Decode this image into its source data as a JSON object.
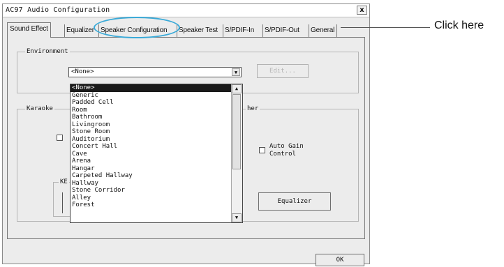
{
  "window": {
    "title": "AC97 Audio Configuration",
    "close_glyph": "x"
  },
  "tabs": [
    {
      "label": "Sound Effect",
      "active": true
    },
    {
      "label": "Equalizer",
      "active": false
    },
    {
      "label": "Speaker Configuration",
      "active": false
    },
    {
      "label": "Speaker Test",
      "active": false
    },
    {
      "label": "S/PDIF-In",
      "active": false
    },
    {
      "label": "S/PDIF-Out",
      "active": false
    },
    {
      "label": "General",
      "active": false
    }
  ],
  "environment": {
    "label": "Environment",
    "selected": "<None>",
    "edit_button": "Edit...",
    "options": [
      "<None>",
      "Generic",
      "Padded Cell",
      "Room",
      "Bathroom",
      "Livingroom",
      "Stone Room",
      "Auditorium",
      "Concert Hall",
      "Cave",
      "Arena",
      "Hangar",
      "Carpeted Hallway",
      "Hallway",
      "Stone Corridor",
      "Alley",
      "Forest"
    ]
  },
  "karaoke": {
    "label": "Karaoke",
    "key_label": "KE"
  },
  "other": {
    "label_fragment": "her",
    "auto_gain_label_line1": "Auto Gain",
    "auto_gain_label_line2": "Control",
    "equalizer_button": "Equalizer"
  },
  "ok_button": "OK",
  "callout": {
    "text": "Click here",
    "highlight_color": "#3aaad8"
  }
}
